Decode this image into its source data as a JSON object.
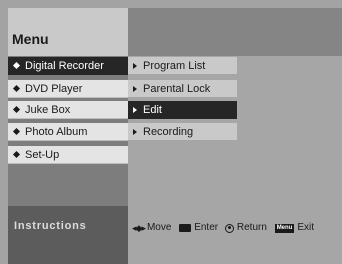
{
  "title": "Menu",
  "main_menu": [
    {
      "label": "Digital Recorder",
      "selected": true
    },
    {
      "label": "DVD Player",
      "selected": false
    },
    {
      "label": "Juke Box",
      "selected": false
    },
    {
      "label": "Photo Album",
      "selected": false
    },
    {
      "label": "Set-Up",
      "selected": false
    }
  ],
  "sub_menu": [
    {
      "label": "Program List",
      "selected": false
    },
    {
      "label": "Parental Lock",
      "selected": false
    },
    {
      "label": "Edit",
      "selected": true
    },
    {
      "label": "Recording",
      "selected": false
    }
  ],
  "instructions": {
    "label": "Instructions",
    "move_label": "Move",
    "enter_label": "Enter",
    "return_label": "Return",
    "menu_key_label": "Menu",
    "exit_label": "Exit"
  },
  "icons": {
    "main_bullet": "diamond-icon",
    "sub_bullet": "arrow-right-icon",
    "move": "directional-pad-icon",
    "enter": "enter-key-icon",
    "return": "return-key-icon",
    "menu": "menu-key-icon"
  },
  "colors": {
    "selected_bg": "#262626",
    "item_bg": "#e4e4e4",
    "sub_item_bg": "#c9c9c9",
    "header_dark": "#858585"
  }
}
